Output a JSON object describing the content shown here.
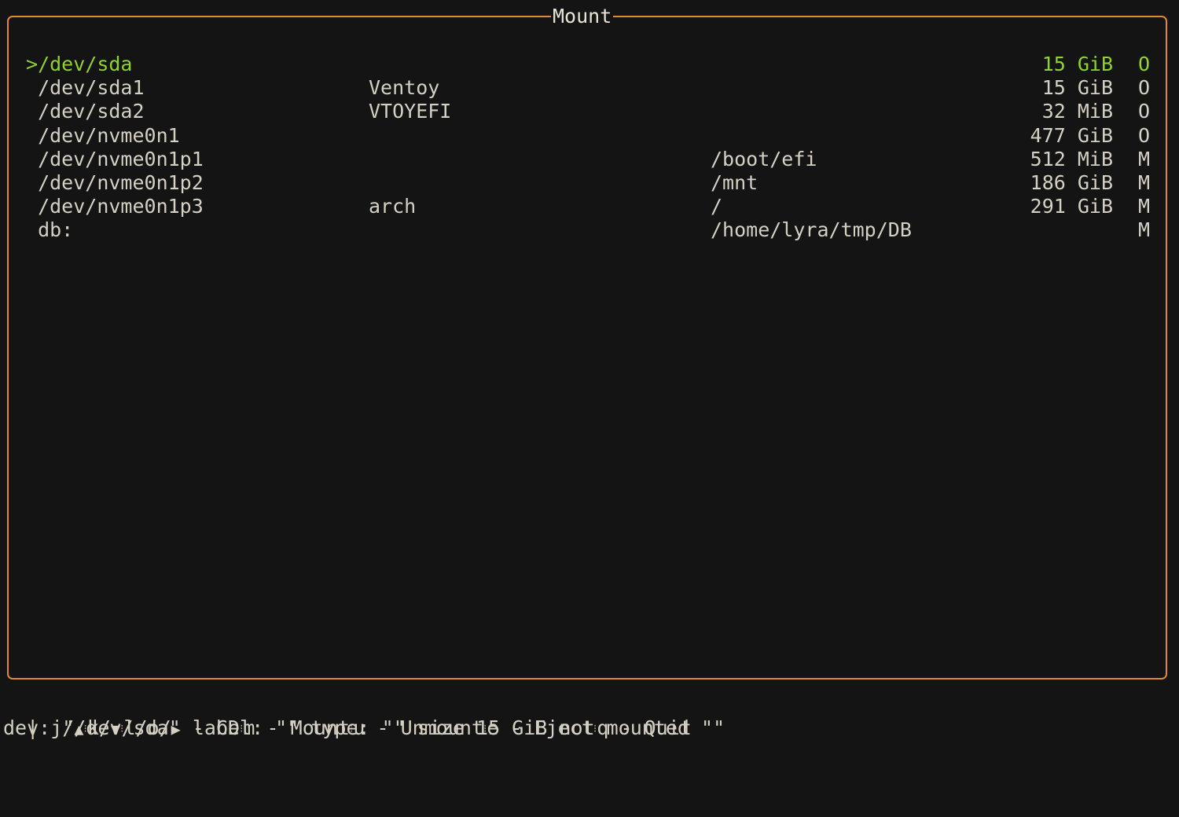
{
  "window": {
    "title": "Mount"
  },
  "devices": [
    {
      "prefix": ">",
      "device": "/dev/sda",
      "label": "",
      "mountpoint": "",
      "size": "15 GiB",
      "state": "O",
      "selected": true
    },
    {
      "prefix": " ",
      "device": "/dev/sda1",
      "label": "Ventoy",
      "mountpoint": "",
      "size": "15 GiB",
      "state": "O",
      "selected": false
    },
    {
      "prefix": " ",
      "device": "/dev/sda2",
      "label": "VTOYEFI",
      "mountpoint": "",
      "size": "32 MiB",
      "state": "O",
      "selected": false
    },
    {
      "prefix": " ",
      "device": "/dev/nvme0n1",
      "label": "",
      "mountpoint": "",
      "size": "477 GiB",
      "state": "O",
      "selected": false
    },
    {
      "prefix": " ",
      "device": "/dev/nvme0n1p1",
      "label": "",
      "mountpoint": "/boot/efi",
      "size": "512 MiB",
      "state": "M",
      "selected": false
    },
    {
      "prefix": " ",
      "device": "/dev/nvme0n1p2",
      "label": "",
      "mountpoint": "/mnt",
      "size": "186 GiB",
      "state": "M",
      "selected": false
    },
    {
      "prefix": " ",
      "device": "/dev/nvme0n1p3",
      "label": "arch",
      "mountpoint": "/",
      "size": "291 GiB",
      "state": "M",
      "selected": false
    },
    {
      "prefix": " ",
      "device": "db:",
      "label": "",
      "mountpoint": "/home/lyra/tmp/DB",
      "size": "",
      "state": "M",
      "selected": false
    }
  ],
  "keybindings": {
    "leading": "| ",
    "items": [
      {
        "key": "j/▲",
        "action": ""
      },
      {
        "key": "k/▼",
        "action": ""
      },
      {
        "key": "l/o/▶",
        "action": "CD"
      },
      {
        "key": "m",
        "action": "Mount"
      },
      {
        "key": "u",
        "action": "Unmount"
      },
      {
        "key": "e",
        "action": "Eject"
      },
      {
        "key": "q",
        "action": "Quit"
      }
    ],
    "separator": "⁝",
    "dash": " - "
  },
  "status_line": "dev: \"/dev/sda\" label: \"\" type: \"\" size 15 GiB not mounted \"\"",
  "colors": {
    "background": "#141414",
    "border": "#e28a2e",
    "text": "#d4d0c4",
    "selected": "#8fd32a"
  }
}
